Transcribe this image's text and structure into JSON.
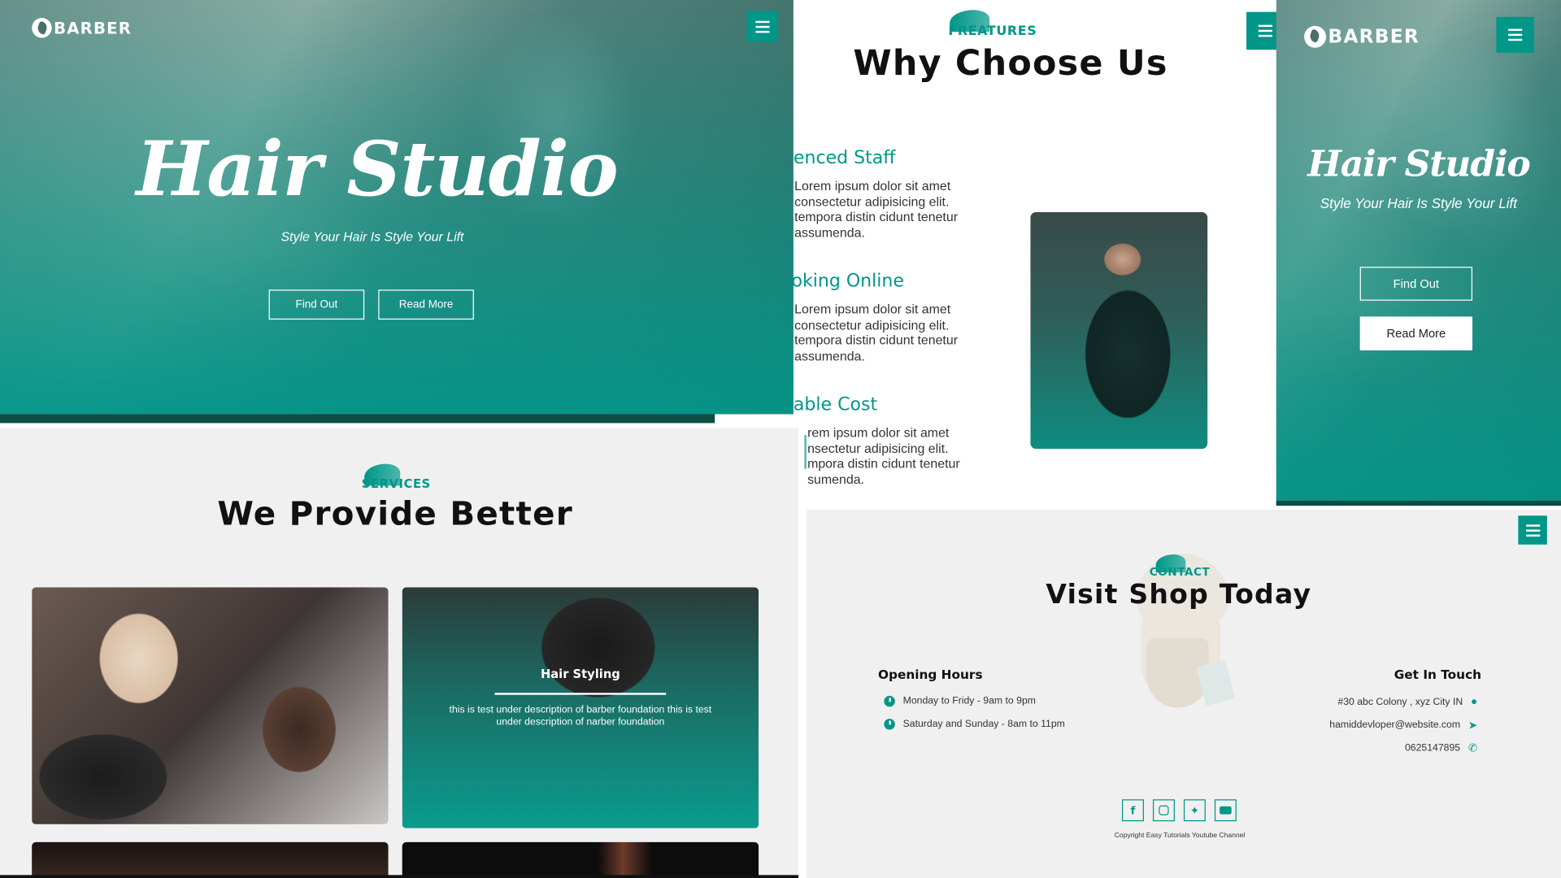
{
  "brand": {
    "logo_text": "BARBER"
  },
  "hero_left": {
    "title": "Hair Studio",
    "tagline": "Style Your Hair Is Style Your Lift",
    "find_out": "Find Out",
    "read_more": "Read More"
  },
  "features": {
    "kicker": "FREATURES",
    "heading": "Why Choose Us",
    "items": [
      {
        "title": "enced Staff",
        "text": "Lorem ipsum dolor sit amet consectetur adipisicing elit. tempora distin cidunt tenetur assumenda."
      },
      {
        "title": "oking Online",
        "text": "Lorem ipsum dolor sit amet consectetur adipisicing elit. tempora distin cidunt tenetur assumenda."
      },
      {
        "title": "able Cost",
        "text": "rem ipsum dolor sit amet nsectetur adipisicing elit. mpora distin cidunt tenetur sumenda."
      }
    ]
  },
  "hero_right": {
    "title": "Hair Studio",
    "tagline": "Style Your Hair Is Style Your Lift",
    "find_out": "Find Out",
    "read_more": "Read More"
  },
  "services": {
    "kicker": "SERVICES",
    "heading": "We Provide Better",
    "card_title": "Hair Styling",
    "card_text": "this is test under description of barber foundation this is test under description of narber foundation"
  },
  "contact": {
    "kicker": "CONTACT",
    "heading": "Visit Shop Today",
    "opening_title": "Opening Hours",
    "hours": [
      "Monday to Fridy - 9am to 9pm",
      "Saturday and Sunday - 8am to 11pm"
    ],
    "touch_title": "Get In Touch",
    "address": "#30 abc Colony , xyz City IN",
    "email": "hamiddevloper@website.com",
    "phone": "0625147895",
    "social": [
      "facebook-icon",
      "instagram-icon",
      "twitter-icon",
      "youtube-icon"
    ],
    "copyright": "Copyright Easy Tutorials Youtube Channel"
  },
  "colors": {
    "accent": "#009688",
    "dark_band": "#0d4d46"
  }
}
